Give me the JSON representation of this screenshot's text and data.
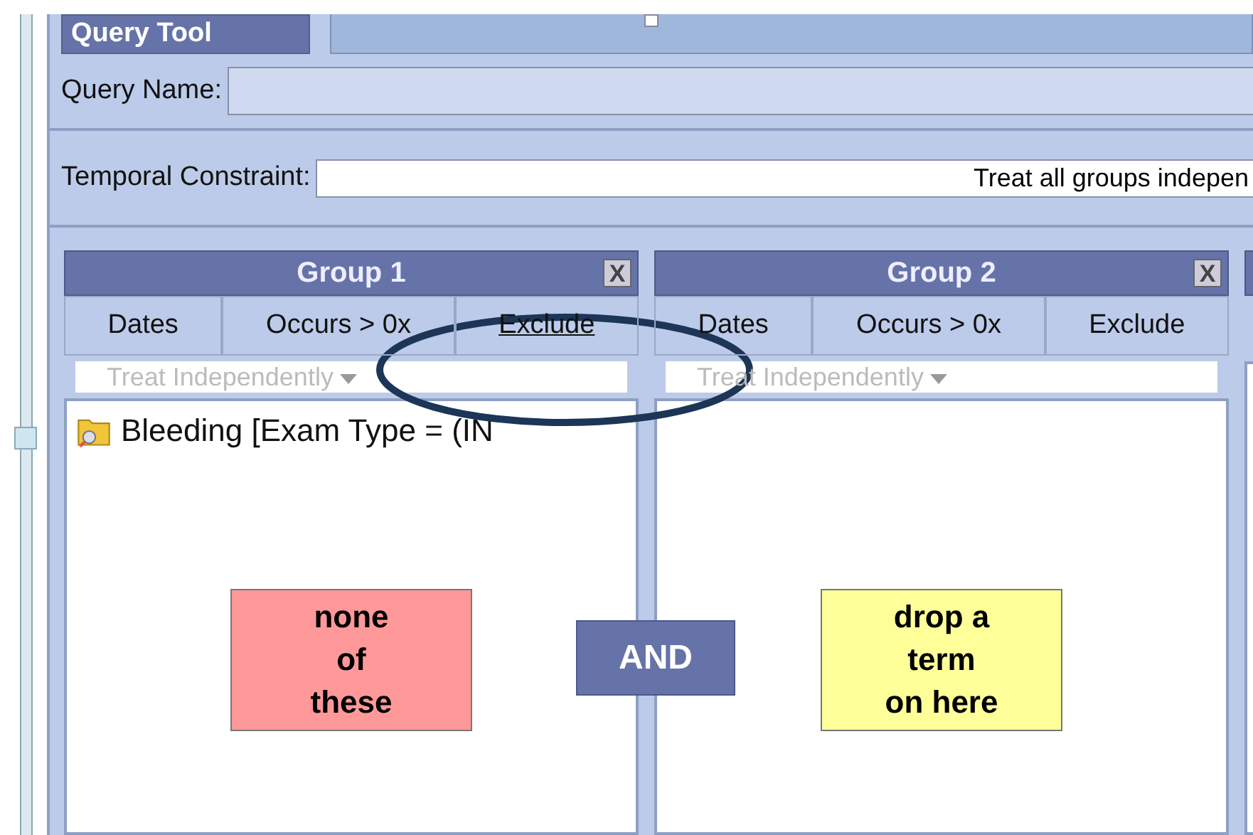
{
  "tab": {
    "label": "Query Tool",
    "selected": true
  },
  "query_name": {
    "label": "Query Name:"
  },
  "temporal_constraint": {
    "label": "Temporal Constraint:",
    "value": "Treat all groups indepen"
  },
  "groups": [
    {
      "title": "Group 1",
      "close": "X",
      "buttons": [
        {
          "label": "Dates",
          "selected": false
        },
        {
          "label": "Occurs > 0x",
          "selected": false
        },
        {
          "label": "Exclude",
          "selected": true
        }
      ],
      "timing": "Treat Independently",
      "items": [
        {
          "label": "Bleeding [Exam Type = (IN"
        }
      ],
      "drop_hint": "none\nof\nthese",
      "excluded": true
    },
    {
      "title": "Group 2",
      "close": "X",
      "buttons": [
        {
          "label": "Dates",
          "selected": false
        },
        {
          "label": "Occurs > 0x",
          "selected": false
        },
        {
          "label": "Exclude",
          "selected": false
        }
      ],
      "timing": "Treat Independently",
      "drop_hint": "drop a\nterm\non here",
      "excluded": false
    }
  ],
  "operator": "AND"
}
